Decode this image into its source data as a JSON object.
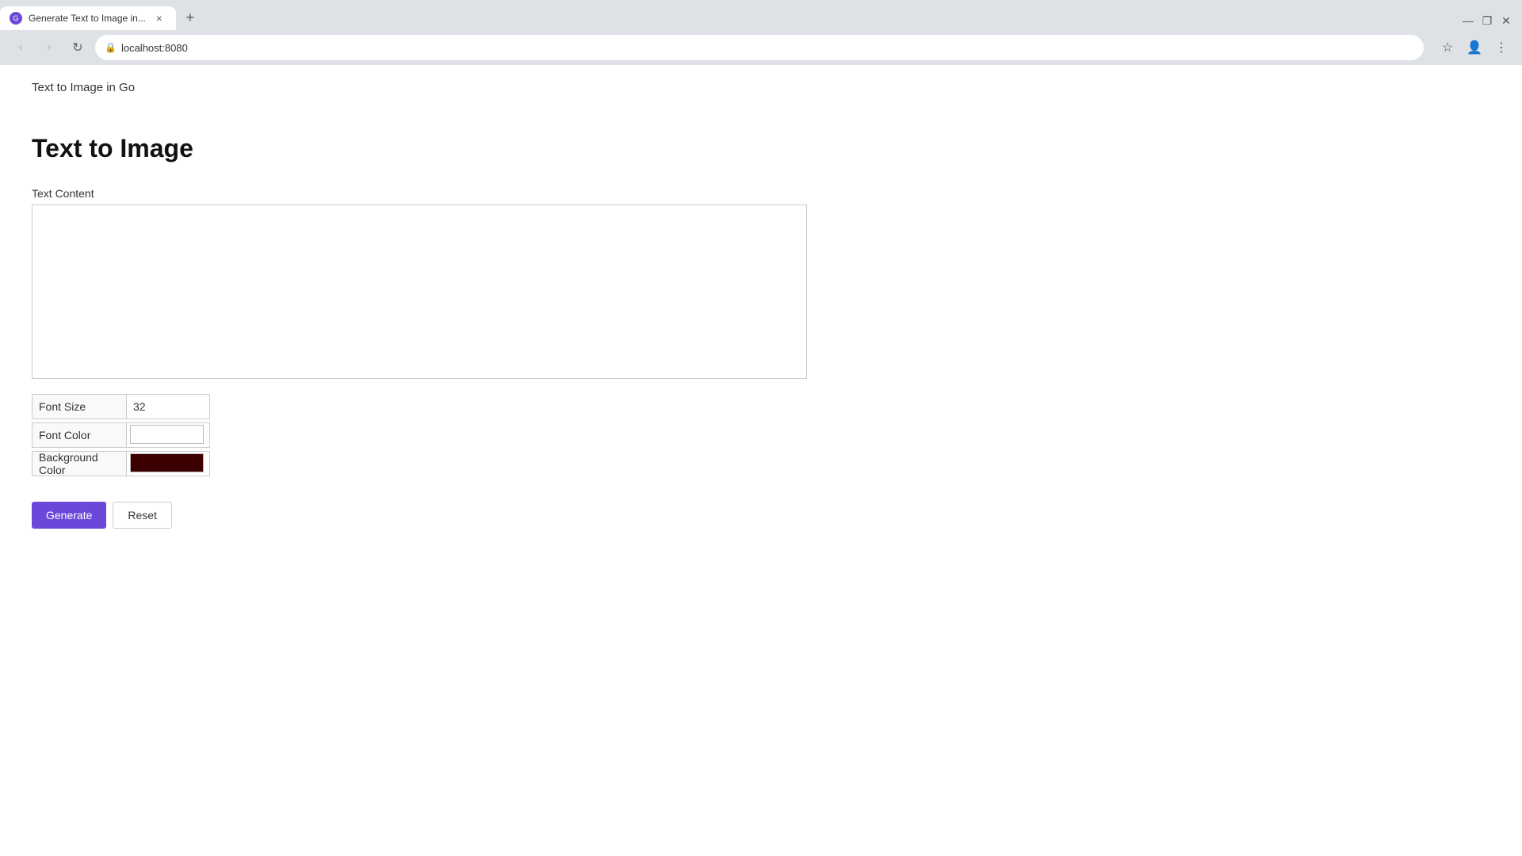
{
  "browser": {
    "tab": {
      "favicon_label": "G",
      "title": "Generate Text to Image in...",
      "close_label": "×"
    },
    "new_tab_label": "+",
    "window_controls": {
      "minimize": "—",
      "maximize": "❐",
      "close": "✕"
    },
    "nav": {
      "back_label": "‹",
      "forward_label": "›",
      "refresh_label": "↻"
    },
    "address": {
      "lock_icon": "🔒",
      "url": "localhost:8080"
    },
    "address_icons": {
      "star": "☆",
      "profile": "👤",
      "menu": "⋮"
    }
  },
  "page": {
    "subtitle": "Text to Image in Go",
    "heading": "Text to Image",
    "text_content_label": "Text Content",
    "text_content_placeholder": "",
    "font_size_label": "Font Size",
    "font_size_value": "32",
    "font_color_label": "Font Color",
    "font_color_value": "#ffffff",
    "background_color_label": "Background Color",
    "background_color_value": "#3d0000",
    "generate_label": "Generate",
    "reset_label": "Reset"
  }
}
